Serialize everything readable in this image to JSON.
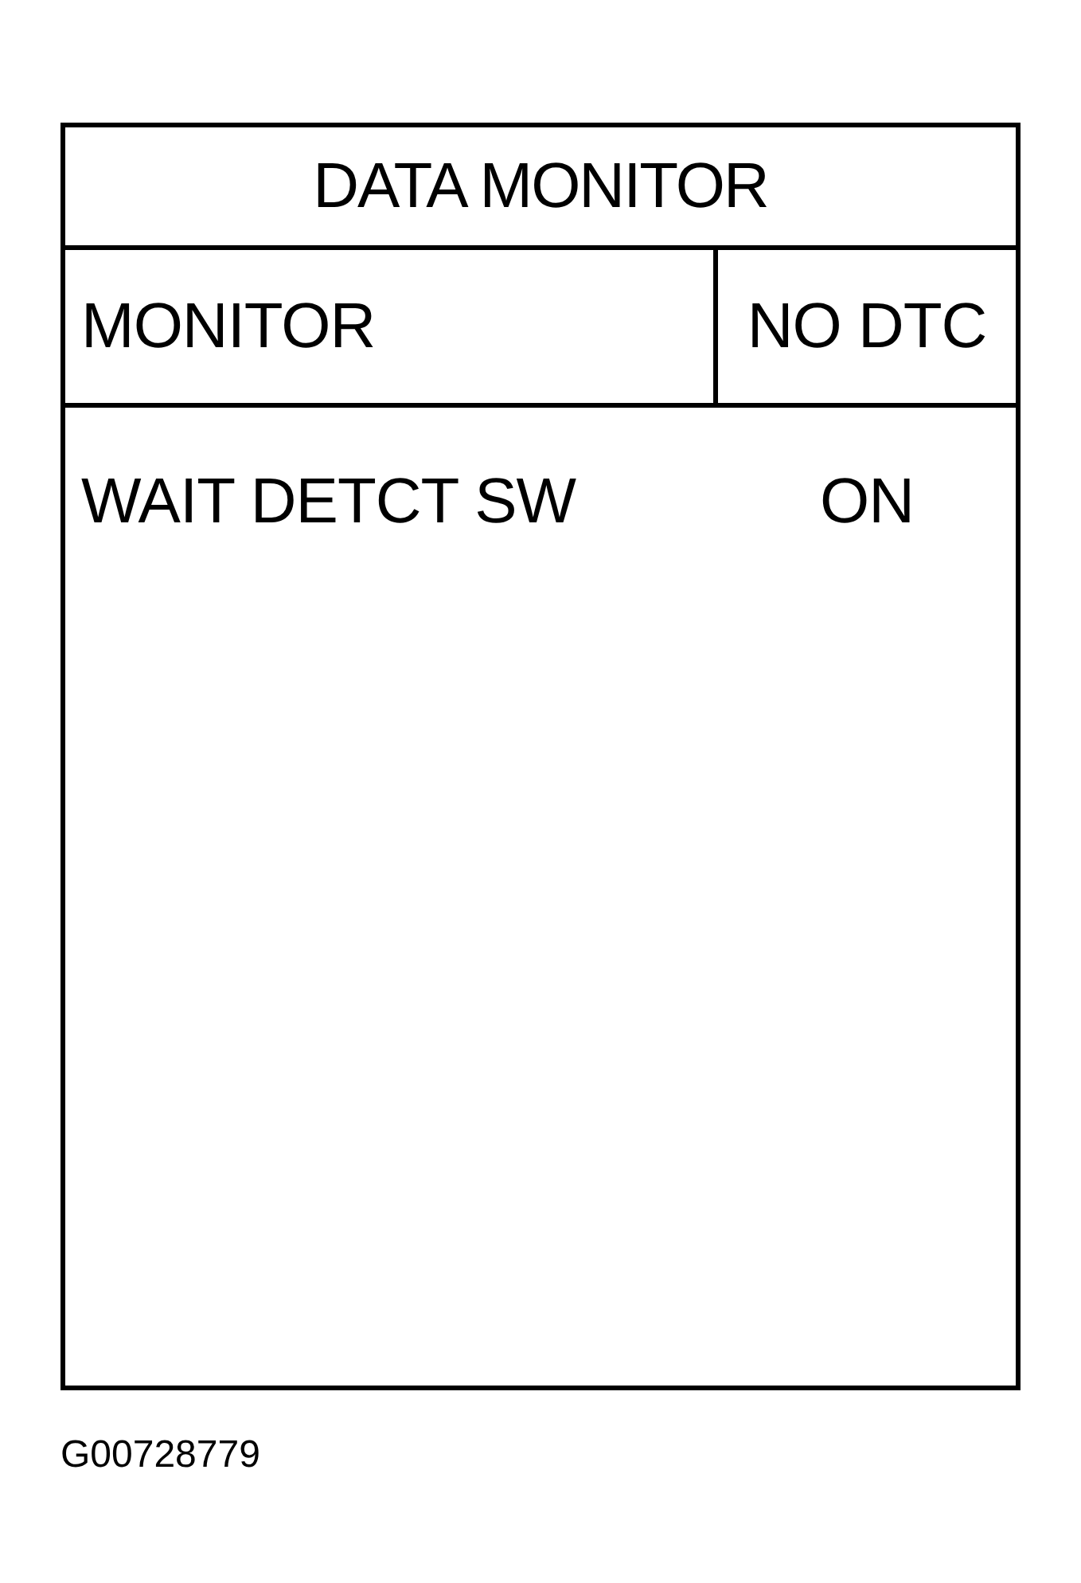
{
  "screen": {
    "title": "DATA MONITOR",
    "header": {
      "label": "MONITOR",
      "status": "NO DTC"
    },
    "rows": [
      {
        "item": "WAIT DETCT SW",
        "value": "ON"
      }
    ]
  },
  "figure_id": "G00728779"
}
